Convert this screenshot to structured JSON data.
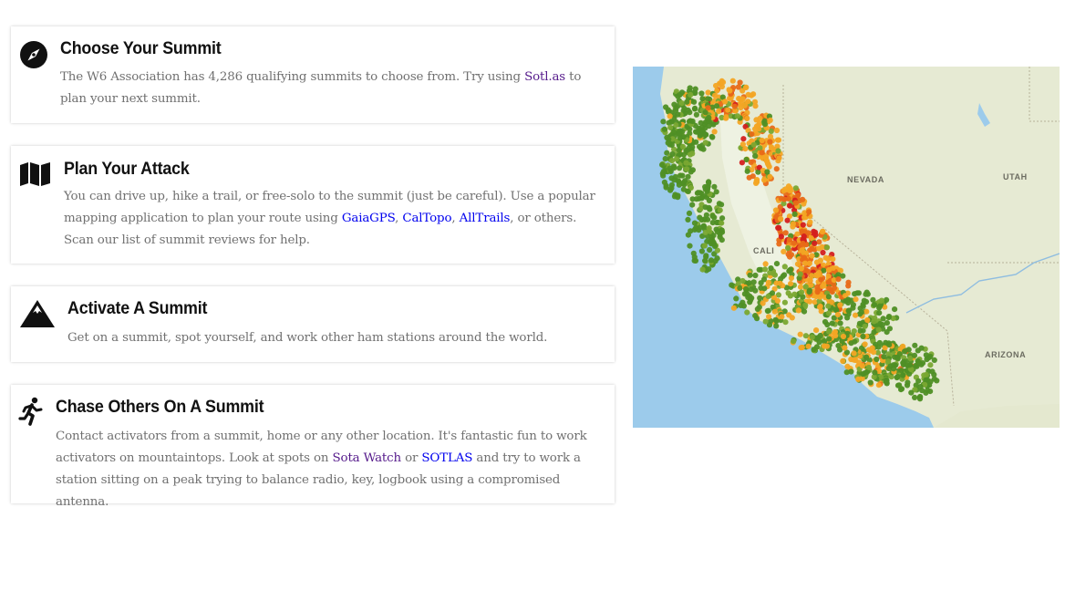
{
  "cards": [
    {
      "icon": "compass-icon",
      "title": "Choose Your Summit",
      "text_1": "The W6 Association has 4,286 qualifying summits to choose from. Try using ",
      "link_1": "Sotl.as",
      "text_2": " to plan your next summit."
    },
    {
      "icon": "map-icon",
      "title": "Plan Your Attack",
      "text_1": "You can drive up, hike a trail, or free-solo to the summit (just be careful). Use a popular mapping application to plan your route using ",
      "link_1": "GaiaGPS",
      "sep_1": ", ",
      "link_2": "CalTopo",
      "sep_2": ", ",
      "link_3": "AllTrails",
      "text_2": ", or others. Scan our list of summit reviews for help."
    },
    {
      "icon": "mountain-icon",
      "title": "Activate A Summit",
      "text_1": "Get on a summit, spot yourself, and work other ham stations around the world."
    },
    {
      "icon": "runner-icon",
      "title": "Chase Others On A Summit",
      "text_1": "Contact activators from a summit, home or any other location. It's fantastic fun to work activators on mountaintops. Look at spots on ",
      "link_1": "Sota Watch",
      "sep_1": " or ",
      "link_2": "SOTLAS",
      "text_2": " and try to work a station sitting on a peak trying to balance radio, key, logbook using a compromised antenna."
    }
  ],
  "map": {
    "labels": {
      "nevada": "NEVADA",
      "utah": "UTAH",
      "arizona": "ARIZONA",
      "cali": "CALI"
    },
    "colors": {
      "ocean": "#9ccbeb",
      "land": "#e8ecd8",
      "valley": "#eef2e4",
      "summit_green": "#4f8f25",
      "summit_green_light": "#7aa832",
      "summit_orange": "#f3a524",
      "summit_dark_orange": "#e86a18",
      "summit_red": "#d41f1f"
    }
  }
}
